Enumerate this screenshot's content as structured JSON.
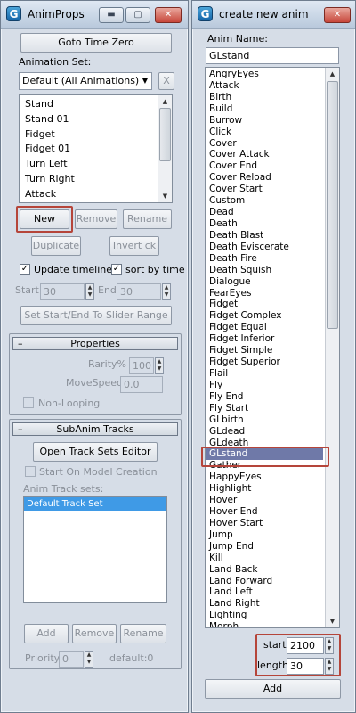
{
  "colors": {
    "highlight_border": "#b5453a",
    "selection": "#3f9ae6",
    "list_selection": "#6f79a8"
  },
  "left_window": {
    "title": "AnimProps",
    "goto_time_zero": "Goto Time Zero",
    "animation_set_label": "Animation Set:",
    "animation_set_value": "Default (All Animations)",
    "x_label": "X",
    "anim_list": [
      "Stand",
      "Stand 01",
      "Fidget",
      "Fidget 01",
      "Turn Left",
      "Turn Right",
      "Attack"
    ],
    "new_label": "New",
    "remove_label": "Remove",
    "rename_label": "Rename",
    "duplicate_label": "Duplicate",
    "invert_label": "Invert ck",
    "update_timeline_label": "Update timeline",
    "update_timeline_checked": true,
    "sort_by_time_label": "sort by time",
    "sort_by_time_checked": true,
    "start_label": "Start",
    "start_value": "30",
    "end_label": "End",
    "end_value": "30",
    "slider_range_label": "Set Start/End To Slider Range",
    "properties": {
      "header": "Properties",
      "rarity_label": "Rarity%",
      "rarity_value": "100",
      "movespeed_label": "MoveSpeed",
      "movespeed_value": "0.0",
      "nonlooping_label": "Non-Looping"
    },
    "subanim": {
      "header": "SubAnim Tracks",
      "open_editor_label": "Open Track Sets Editor",
      "start_on_creation_label": "Start On Model Creation",
      "track_sets_label": "Anim Track sets:",
      "track_sets": [
        "Default Track Set"
      ],
      "add_label": "Add",
      "remove_label": "Remove",
      "rename_label": "Rename",
      "priority_label": "Priority",
      "priority_value": "0",
      "default_text": "default:0"
    }
  },
  "right_window": {
    "title": "create new anim",
    "anim_name_label": "Anim Name:",
    "anim_name_value": "GLstand",
    "selected_item": "GLstand",
    "anim_names": [
      "AngryEyes",
      "Attack",
      "Birth",
      "Build",
      "Burrow",
      "Click",
      "Cover",
      "Cover Attack",
      "Cover End",
      "Cover Reload",
      "Cover Start",
      "Custom",
      "Dead",
      "Death",
      "Death Blast",
      "Death Eviscerate",
      "Death Fire",
      "Death Squish",
      "Dialogue",
      "FearEyes",
      "Fidget",
      "Fidget Complex",
      "Fidget Equal",
      "Fidget Inferior",
      "Fidget Simple",
      "Fidget Superior",
      "Flail",
      "Fly",
      "Fly End",
      "Fly Start",
      "GLbirth",
      "GLdead",
      "GLdeath",
      "GLstand",
      "Gather",
      "HappyEyes",
      "Highlight",
      "Hover",
      "Hover End",
      "Hover Start",
      "Jump",
      "Jump End",
      "Kill",
      "Land Back",
      "Land Forward",
      "Land Left",
      "Land Right",
      "Lighting",
      "Morph"
    ],
    "start_label": "start",
    "start_value": "2100",
    "length_label": "length",
    "length_value": "30",
    "add_label": "Add"
  }
}
